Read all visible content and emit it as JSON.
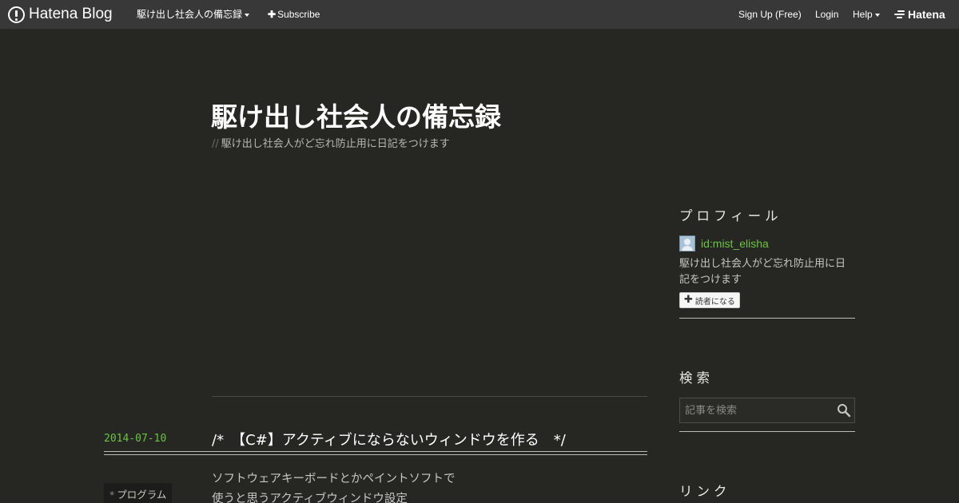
{
  "topbar": {
    "logo": "Hatena Blog",
    "blog_menu": "駆け出し社会人の備忘録",
    "subscribe": "Subscribe",
    "signup": "Sign Up (Free)",
    "login": "Login",
    "help": "Help",
    "brand": "Hatena"
  },
  "blog": {
    "title": "駆け出し社会人の備忘録",
    "description_prefix": "//",
    "description": "駆け出し社会人がど忘れ防止用に日記をつけます"
  },
  "entry": {
    "date": "2014-07-10",
    "title": "/*　【C#】アクティブにならないウィンドウを作る　*/",
    "category_prefix": "*",
    "category": "プログラム",
    "body_lines": [
      "ソフトウェアキーボードとかペイントソフトで",
      "使うと思うアクティブウィンドウ設定"
    ]
  },
  "sidebar": {
    "profile_heading": "プロフィール",
    "profile_id": "id:mist_elisha",
    "profile_desc": "駆け出し社会人がど忘れ防止用に日記をつけます",
    "reader_button": "読者になる",
    "search_heading": "検索",
    "search_placeholder": "記事を検索",
    "links_heading": "リンク"
  },
  "colors": {
    "background": "#262623",
    "topbar": "#383838",
    "accent_green": "#6bc246",
    "text": "#c8c8c2"
  }
}
